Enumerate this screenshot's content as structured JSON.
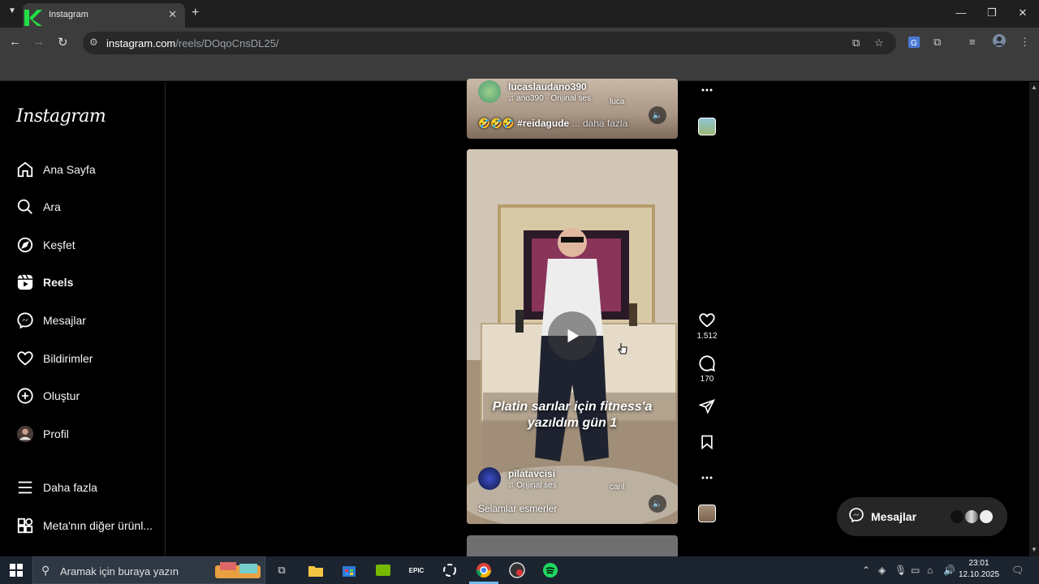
{
  "browser": {
    "tab_title": "Instagram",
    "url_host": "instagram.com",
    "url_path": "/reels/DOqoCnsDL25/"
  },
  "sidebar": {
    "logo": "Instagram",
    "items": [
      {
        "label": "Ana Sayfa",
        "icon": "home-icon"
      },
      {
        "label": "Ara",
        "icon": "search-icon"
      },
      {
        "label": "Keşfet",
        "icon": "compass-icon"
      },
      {
        "label": "Reels",
        "icon": "reels-icon",
        "active": true
      },
      {
        "label": "Mesajlar",
        "icon": "messenger-icon"
      },
      {
        "label": "Bildirimler",
        "icon": "heart-icon"
      },
      {
        "label": "Oluştur",
        "icon": "plus-square-icon"
      },
      {
        "label": "Profil",
        "icon": "avatar"
      },
      {
        "label": "Daha fazla",
        "icon": "menu-icon"
      },
      {
        "label": "Meta'nın diğer ürünl...",
        "icon": "apps-icon"
      }
    ]
  },
  "reels": {
    "prev": {
      "username": "lucaslaudano390",
      "audio": "ano390 · Orijinal ses",
      "audio_extra": "luca",
      "caption_emojis": "🤣🤣🤣",
      "caption_tag": "#reidagude",
      "caption_more": "... daha fazla"
    },
    "current": {
      "overlay_line1": "Platin sarılar için fitness'a",
      "overlay_line2": "yazıldım gün 1",
      "username": "pilatavcisi",
      "audio": "Orijinal ses",
      "audio_extra": "canl",
      "caption": "Selamlar esmerler",
      "likes": "1.512",
      "comments": "170"
    }
  },
  "messages_pill": {
    "label": "Mesajlar"
  },
  "taskbar": {
    "search_placeholder": "Aramak için buraya yazın",
    "time": "23:01",
    "date": "12.10.2025"
  },
  "colors": {
    "accent": "#0095f6",
    "bg": "#000000",
    "taskbar": "#1c2430"
  }
}
